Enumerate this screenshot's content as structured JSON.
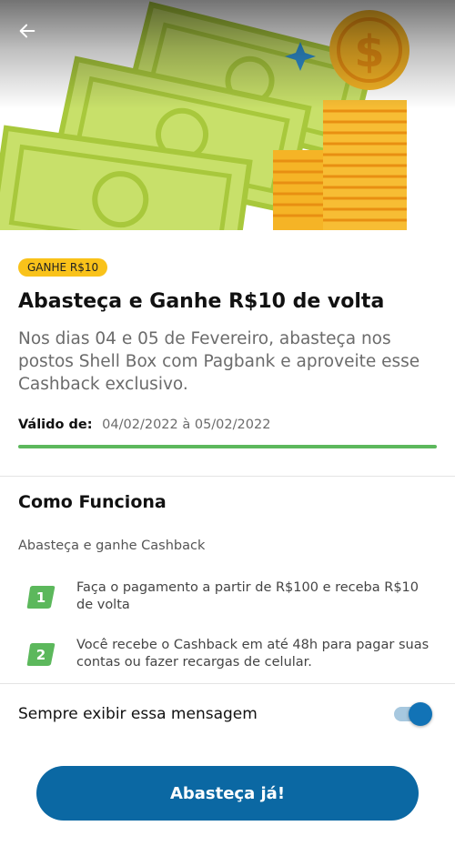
{
  "header": {
    "back_icon": "arrow-left-icon"
  },
  "hero": {
    "illustration": "cash-bills-and-coins-illustration",
    "colors": {
      "bill": "#c8e06a",
      "bill_dark": "#a8c83c",
      "coin": "#f5b426",
      "coin_dark": "#e88f12",
      "sparkle": "#2f8fd0"
    }
  },
  "offer": {
    "badge": "GANHE R$10",
    "title": "Abasteça e Ganhe R$10 de volta",
    "description": "Nos dias 04 e 05 de Fevereiro, abasteça nos postos Shell Box com Pagbank e aproveite esse Cashback exclusivo.",
    "valid_label": "Válido de:",
    "valid_dates": "04/02/2022 à 05/02/2022",
    "progress": 1.0
  },
  "how_it_works": {
    "title": "Como Funciona",
    "subtitle": "Abasteça e ganhe Cashback",
    "steps": [
      {
        "number": "1",
        "text": "Faça o pagamento a partir de R$100 e receba R$10 de volta"
      },
      {
        "number": "2",
        "text": "Você recebe o Cashback em até 48h para pagar suas contas ou fazer recargas de celular."
      }
    ]
  },
  "settings": {
    "always_show_label": "Sempre exibir essa mensagem",
    "always_show_enabled": true
  },
  "cta": {
    "label": "Abasteça já!"
  },
  "colors": {
    "accent": "#0b68a3",
    "badge": "#f9c21a",
    "step": "#5cb85c",
    "progress": "#5cb85c"
  }
}
